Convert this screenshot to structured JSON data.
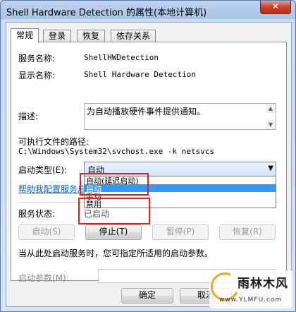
{
  "window": {
    "title": "Shell Hardware Detection 的属性(本地计算机)",
    "close_label": "✕"
  },
  "tabs": [
    {
      "label": "常规",
      "active": true
    },
    {
      "label": "登录",
      "active": false
    },
    {
      "label": "恢复",
      "active": false
    },
    {
      "label": "依存关系",
      "active": false
    }
  ],
  "general": {
    "service_name_label": "服务名称:",
    "service_name": "ShellHWDetection",
    "display_name_label": "显示名称:",
    "display_name": "Shell Hardware Detection",
    "description_label": "描述:",
    "description": "为自动播放硬件事件提供通知。",
    "path_label": "可执行文件的路径:",
    "path": "C:\\Windows\\System32\\svchost.exe -k netsvcs",
    "startup_type_label": "启动类型(E):",
    "startup_type_value": "自动",
    "startup_options": [
      "自动(延迟启动)",
      "自动",
      "手动",
      "禁用"
    ],
    "selected_option_index": 1,
    "help_link": "帮助我配置服务启动",
    "status_label": "服务状态:",
    "status_value": "已启动"
  },
  "service_buttons": {
    "start": "启动(S)",
    "stop": "停止(T)",
    "pause": "暂停(P)",
    "resume": "恢复(R)"
  },
  "start_params": {
    "hint": "当从此处启动服务时，您可指定所适用的启动参数。",
    "label": "启动参数(M):",
    "value": ""
  },
  "dialog_buttons": {
    "ok": "确定",
    "cancel": "取消"
  },
  "watermark": {
    "brand": "雨林木风",
    "url": "www.YLMFU.com"
  },
  "colors": {
    "selection": "#3399ff",
    "highlight": "#e02020",
    "link": "#0066cc"
  }
}
